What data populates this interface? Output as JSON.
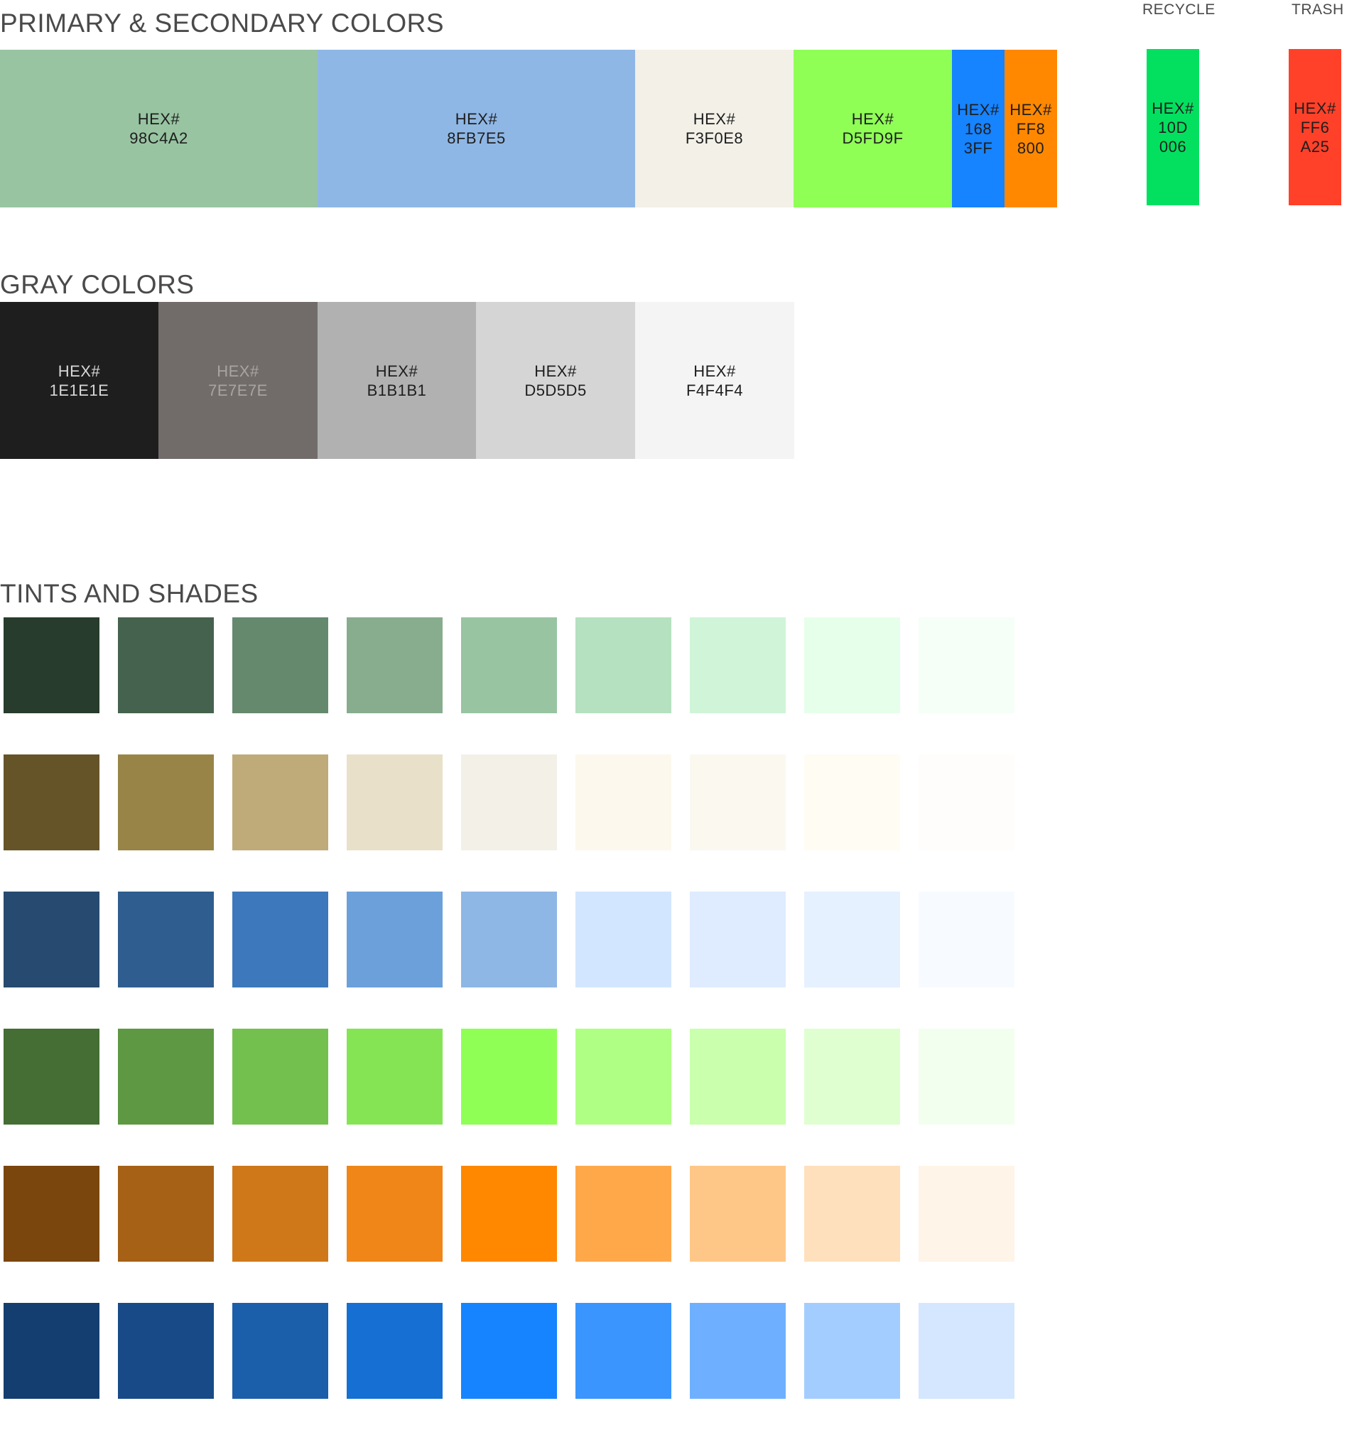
{
  "sections": {
    "primary_title": "PRIMARY & SECONDARY COLORS",
    "gray_title": "GRAY COLORS",
    "tints_title": "TINTS AND SHADES"
  },
  "primary_swatches": [
    {
      "label": "HEX#",
      "value": "98C4A2",
      "color": "#98C4A2",
      "text_color": "#1e1e1e"
    },
    {
      "label": "HEX#",
      "value": "8FB7E5",
      "color": "#8FB7E5",
      "text_color": "#1e1e1e"
    },
    {
      "label": "HEX#",
      "value": "F3F0E8",
      "color": "#F3F0E8",
      "text_color": "#1e1e1e"
    },
    {
      "label": "HEX#",
      "value": "D5FD9F",
      "color": "#8FFF56",
      "text_color": "#1e1e1e"
    },
    {
      "label": "HEX#",
      "value": "168\n3FF",
      "color": "#1683FF",
      "text_color": "#1e1e1e"
    },
    {
      "label": "HEX#",
      "value": "FF8\n800",
      "color": "#FF8800",
      "text_color": "#1e1e1e"
    }
  ],
  "recycle": {
    "heading": "RECYCLE",
    "label": "HEX#",
    "value": "10D\n006",
    "color": "#03E060"
  },
  "trash": {
    "heading": "TRASH",
    "label": "HEX#",
    "value": "FF6\nA25",
    "color": "#FF4129"
  },
  "gray_swatches": [
    {
      "label": "HEX#",
      "value": "1E1E1E",
      "color": "#1E1E1E",
      "text_color": "#d8d8d8"
    },
    {
      "label": "HEX#",
      "value": "7E7E7E",
      "color": "#716C6A",
      "text_color": "#a8a4a2"
    },
    {
      "label": "HEX#",
      "value": "B1B1B1",
      "color": "#B1B1B1",
      "text_color": "#1e1e1e"
    },
    {
      "label": "HEX#",
      "value": "D5D5D5",
      "color": "#D5D5D5",
      "text_color": "#1e1e1e"
    },
    {
      "label": "HEX#",
      "value": "F4F4F4",
      "color": "#F4F4F4",
      "text_color": "#1e1e1e"
    }
  ],
  "tints_and_shades": [
    [
      "#273C2C",
      "#44624D",
      "#65896D",
      "#87AD8E",
      "#98C4A2",
      "#B5E1C0",
      "#CFF4D8",
      "#E6FFEA",
      "#F5FFF7"
    ],
    [
      "#655427",
      "#978446",
      "#BFAB79",
      "#E8E0C9",
      "#F3F0E8",
      "#FCF8ED",
      "#FBF8F0",
      "#FFFCF4",
      "#FEFDFB"
    ],
    [
      "#264A70",
      "#2F5D8F",
      "#3C78BB",
      "#6BA0DA",
      "#8FB7E5",
      "#D3E6FF",
      "#DFECFF",
      "#E6F1FF",
      "#F7FAFF"
    ],
    [
      "#446E33",
      "#5E9842",
      "#74C04E",
      "#84E454",
      "#8FFF56",
      "#AFFF84",
      "#CAFFAD",
      "#DFFFD1",
      "#F3FFEE"
    ],
    [
      "#7A460E",
      "#A66116",
      "#CF7819",
      "#EF8617",
      "#FF8800",
      "#FFA84A",
      "#FEC787",
      "#FFE0BD",
      "#FEF4E8"
    ],
    [
      "#143E6F",
      "#174A87",
      "#1B5EA9",
      "#166FD3",
      "#1683FF",
      "#3A95FF",
      "#6EB0FF",
      "#A4CDFF",
      "#D5E6FF"
    ]
  ]
}
